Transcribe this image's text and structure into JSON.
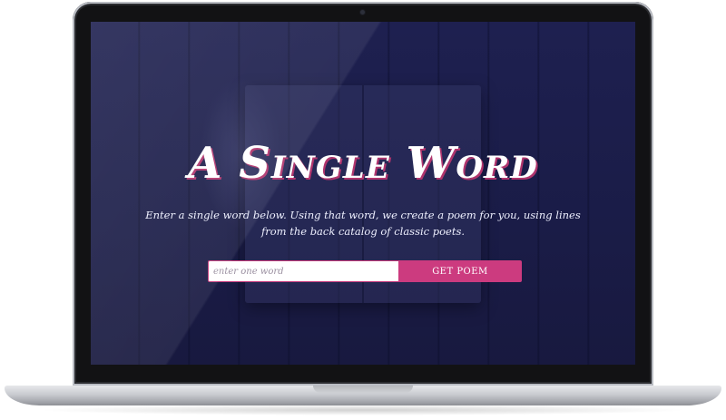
{
  "page": {
    "title": "A Single Word",
    "description": "Enter a single word below. Using that word, we create a poem for you, using lines from the back catalog of classic poets."
  },
  "form": {
    "input_placeholder": "enter one word",
    "input_value": "",
    "button_label": "GET POEM"
  },
  "colors": {
    "background": "#1b1d4a",
    "accent": "#cc3b7f",
    "title_shadow": "#b0356d"
  }
}
